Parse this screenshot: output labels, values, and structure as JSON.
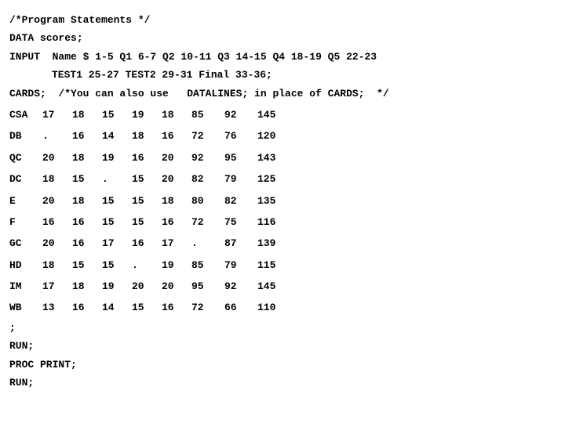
{
  "lines": {
    "comment1": "/*Program Statements */",
    "data": "DATA scores;",
    "input1": "INPUT  Name $ 1-5 Q1 6-7 Q2 10-11 Q3 14-15 Q4 18-19 Q5 22-23",
    "input2": "TEST1 25-27 TEST2 29-31 Final 33-36;",
    "cards": "CARDS;  /*You can also use   DATALINES; in place of CARDS;  */",
    "semicolon": ";",
    "run1": "RUN;",
    "proc": "PROC PRINT;",
    "run2": "RUN;"
  },
  "table": {
    "rows": [
      {
        "name": "CSA",
        "q1": "17",
        "q2": "18",
        "q3": "15",
        "q4": "19",
        "q5": "18",
        "t1": "85",
        "t2": "92",
        "f": "145"
      },
      {
        "name": " DB",
        "q1": ".",
        "q2": "16",
        "q3": "14",
        "q4": "18",
        "q5": "16",
        "t1": "72",
        "t2": "76",
        "f": "120"
      },
      {
        "name": "QC",
        "q1": "20",
        "q2": "18",
        "q3": "19",
        "q4": "16",
        "q5": "20",
        "t1": "92",
        "t2": "95",
        "f": "143"
      },
      {
        "name": "DC",
        "q1": "18",
        "q2": "15",
        "q3": ".",
        "q4": "15",
        "q5": "20",
        "t1": "82",
        "t2": "79",
        "f": "125"
      },
      {
        "name": "E",
        "q1": "20",
        "q2": "18",
        "q3": "15",
        "q4": "15",
        "q5": "18",
        "t1": "80",
        "t2": "82",
        "f": "135"
      },
      {
        "name": "F",
        "q1": "16",
        "q2": "16",
        "q3": "15",
        "q4": "15",
        "q5": "16",
        "t1": "72",
        "t2": "75",
        "f": "116"
      },
      {
        "name": "GC",
        "q1": "20",
        "q2": "16",
        "q3": "17",
        "q4": "16",
        "q5": "17",
        "t1": ".",
        "t2": "87",
        "f": "139"
      },
      {
        "name": "HD",
        "q1": "18",
        "q2": "15",
        "q3": "15",
        "q4": " .",
        "q5": "19",
        "t1": "85",
        "t2": "79",
        "f": "115"
      },
      {
        "name": "IM",
        "q1": "17",
        "q2": "18",
        "q3": "19",
        "q4": "20",
        "q5": "20",
        "t1": "95",
        "t2": "92",
        "f": "145"
      },
      {
        "name": "WB",
        "q1": "13",
        "q2": "16",
        "q3": "14",
        "q4": "15",
        "q5": "16",
        "t1": "72",
        "t2": "66",
        "f": "110"
      }
    ]
  }
}
